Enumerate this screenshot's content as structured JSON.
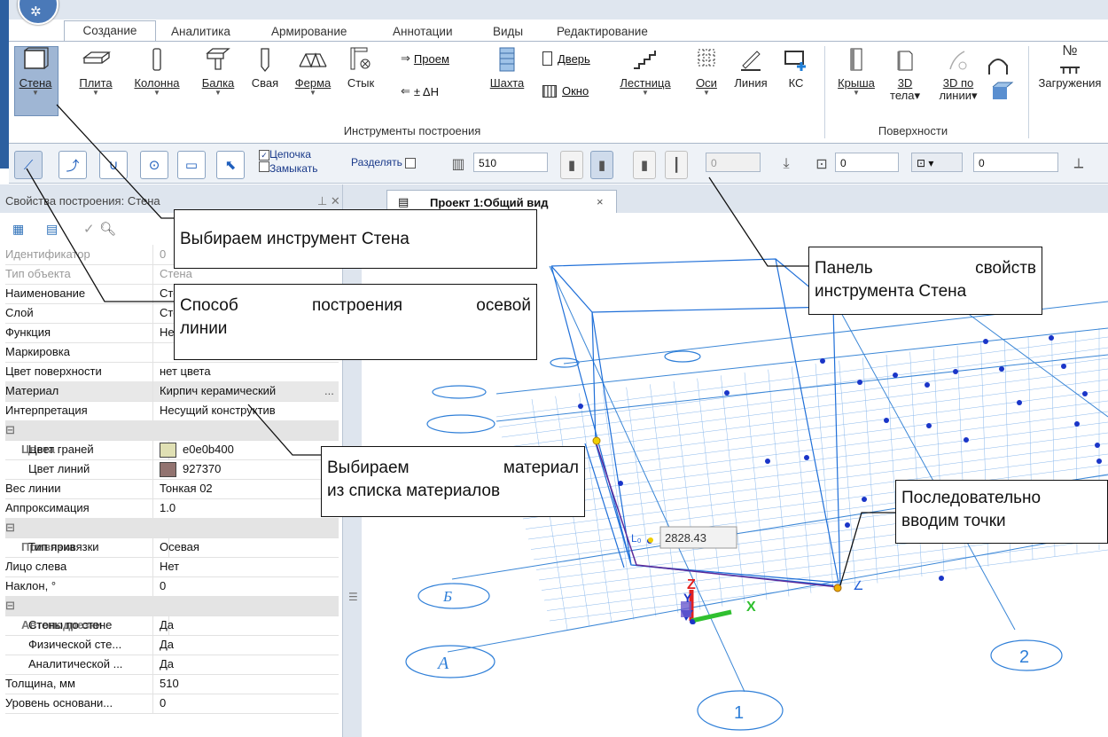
{
  "ribbon": {
    "tabs": [
      "Создание",
      "Аналитика",
      "Армирование",
      "Аннотации",
      "Виды",
      "Редактирование"
    ],
    "active_tab": "Создание",
    "buttons": {
      "stena": "Стена",
      "plita": "Плита",
      "kolonna": "Колонна",
      "balka": "Балка",
      "svaya": "Свая",
      "ferma": "Ферма",
      "styk": "Стык",
      "proem": "Проем",
      "dh": "± ΔH",
      "shahta": "Шахта",
      "dver": "Дверь",
      "okno": "Окно",
      "lestnica": "Лестница",
      "osi": "Оси",
      "liniya": "Линия",
      "ks": "КС",
      "krysha": "Крыша",
      "tela3d_a": "3D",
      "tela3d_b": "тела",
      "po3d_a": "3D по",
      "po3d_b": "линии",
      "zagruzheniya": "Загружения",
      "nomer": "№"
    },
    "groups": {
      "build_tools": "Инструменты построения",
      "surfaces": "Поверхности"
    }
  },
  "toolbar": {
    "chain": "Цепочка",
    "close": "Замыкать",
    "split": "Разделять",
    "thickness": "510",
    "offset": "0",
    "level1": "0",
    "level2": "0"
  },
  "panel": {
    "title": "Свойства построения: Стена",
    "pin": "⊥ ✕",
    "rows": [
      {
        "k": "Идентификатор",
        "v": "0",
        "cls": "dim"
      },
      {
        "k": "Тип объекта",
        "v": "Стена",
        "cls": "dim"
      },
      {
        "k": "Наименование",
        "v": "Стена",
        "cls": ""
      },
      {
        "k": "Слой",
        "v": "Стены",
        "cls": ""
      },
      {
        "k": "Функция",
        "v": "Несущая",
        "cls": ""
      },
      {
        "k": "Маркировка",
        "v": "",
        "cls": ""
      },
      {
        "k": "Цвет поверхности",
        "v": "нет цвета",
        "cls": ""
      },
      {
        "k": "Материал",
        "v": "Кирпич керамический",
        "cls": "hi"
      },
      {
        "k": "Интерпретация",
        "v": "Несущий конструктив",
        "cls": ""
      },
      {
        "k": "Цвета",
        "v": "",
        "cls": "sec"
      },
      {
        "k": "Цвет граней",
        "v": "e0e0b400",
        "cls": "ind",
        "swatch": "#e0e0b4"
      },
      {
        "k": "Цвет линий",
        "v": "927370",
        "cls": "ind",
        "swatch": "#927370"
      },
      {
        "k": "Вес линии",
        "v": "Тонкая 02",
        "cls": ""
      },
      {
        "k": "Аппроксимация",
        "v": "1.0",
        "cls": ""
      },
      {
        "k": "Привязка",
        "v": "",
        "cls": "sec"
      },
      {
        "k": "Тип привязки",
        "v": "Осевая",
        "cls": "ind"
      },
      {
        "k": "Лицо слева",
        "v": "Нет",
        "cls": ""
      },
      {
        "k": "Наклон, °",
        "v": "0",
        "cls": ""
      },
      {
        "k": "Автоподрезки",
        "v": "",
        "cls": "sec"
      },
      {
        "k": "Стены по стене",
        "v": "Да",
        "cls": "ind"
      },
      {
        "k": "Физической сте...",
        "v": "Да",
        "cls": "ind"
      },
      {
        "k": "Аналитической ...",
        "v": "Да",
        "cls": "ind"
      },
      {
        "k": "Толщина, мм",
        "v": "510",
        "cls": ""
      },
      {
        "k": "Уровень основани...",
        "v": "0",
        "cls": ""
      }
    ]
  },
  "document": {
    "tab": "Проект 1:Общий вид",
    "close": "×"
  },
  "viewport": {
    "axes_letters": [
      "А",
      "Б"
    ],
    "axes_numbers": [
      "1",
      "2"
    ],
    "length_tooltip": "2828.43",
    "x": "X",
    "y": "Y",
    "z": "Z"
  },
  "callouts": {
    "c1": "Выбираем инструмент Стена",
    "c2_a": "Способ построения осевой",
    "c2_b": "линии",
    "c3_a": "Панель свойств",
    "c3_b": "инструмента Стена",
    "c4_a": "Выбираем материал",
    "c4_b": "из списка материалов",
    "c5_a": "Последовательно",
    "c5_b": "вводим точки"
  },
  "colors": {
    "accent": "#2c5fa0",
    "selected": "#9fb6d4",
    "grid": "#3a86d6",
    "wall": "#1f6fd8"
  }
}
